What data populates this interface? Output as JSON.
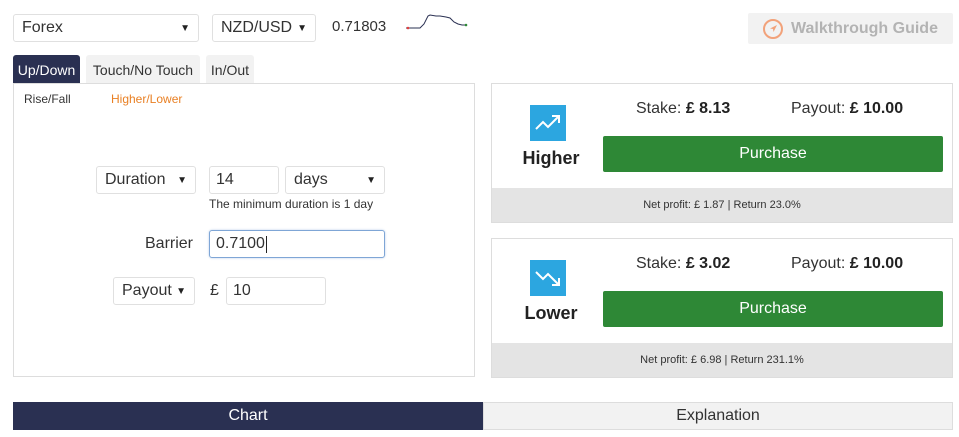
{
  "top_bar": {
    "market_select": "Forex",
    "symbol_select": "NZD/USD",
    "spot_price": "0.71803",
    "walkthrough_label": "Walkthrough Guide"
  },
  "contract_tabs": [
    "Up/Down",
    "Touch/No Touch",
    "In/Out"
  ],
  "sub_tabs": [
    "Rise/Fall",
    "Higher/Lower"
  ],
  "form": {
    "duration_type": "Duration",
    "duration_value": "14",
    "duration_unit": "days",
    "duration_hint": "The minimum duration is 1 day",
    "barrier_label": "Barrier",
    "barrier_value": "0.7100",
    "amount_type": "Payout",
    "currency_symbol": "£",
    "amount_value": "10"
  },
  "cards": {
    "higher": {
      "name": "Higher",
      "stake_label": "Stake:",
      "stake_value": "£ 8.13",
      "payout_label": "Payout:",
      "payout_value": "£ 10.00",
      "purchase_label": "Purchase",
      "net_profit": "Net profit: £ 1.87 | Return 23.0%"
    },
    "lower": {
      "name": "Lower",
      "stake_label": "Stake:",
      "stake_value": "£ 3.02",
      "payout_label": "Payout:",
      "payout_value": "£ 10.00",
      "purchase_label": "Purchase",
      "net_profit": "Net profit: £ 6.98 | Return 231.1%"
    }
  },
  "bottom_tabs": [
    "Chart",
    "Explanation"
  ],
  "colors": {
    "nav_dark": "#2a3052",
    "accent_orange": "#e98024",
    "purchase_green": "#2e8836",
    "icon_blue": "#2ca6e0"
  },
  "icons": {
    "walkthrough": "compass-icon",
    "higher": "trend-up-icon",
    "lower": "trend-down-icon"
  }
}
